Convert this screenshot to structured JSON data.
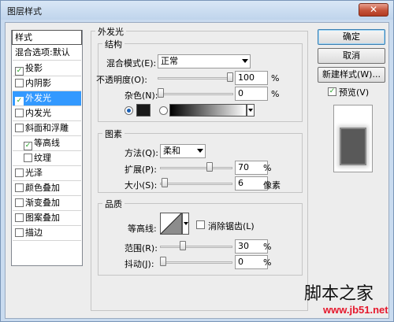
{
  "window": {
    "title": "图层样式",
    "close_label": "✕"
  },
  "style_list": {
    "header": "样式",
    "blend_default": "混合选项:默认",
    "items": [
      {
        "label": "投影",
        "checked": true
      },
      {
        "label": "内阴影",
        "checked": false
      },
      {
        "label": "外发光",
        "checked": true,
        "selected": true
      },
      {
        "label": "内发光",
        "checked": false
      },
      {
        "label": "斜面和浮雕",
        "checked": false
      },
      {
        "label": "等高线",
        "checked": true,
        "indent": true
      },
      {
        "label": "纹理",
        "checked": false,
        "indent": true
      },
      {
        "label": "光泽",
        "checked": false
      },
      {
        "label": "颜色叠加",
        "checked": false
      },
      {
        "label": "渐变叠加",
        "checked": false
      },
      {
        "label": "图案叠加",
        "checked": false
      },
      {
        "label": "描边",
        "checked": false
      }
    ]
  },
  "outer_glow": {
    "title": "外发光",
    "structure": {
      "title": "结构",
      "blend_mode_label": "混合模式(E):",
      "blend_mode_value": "正常",
      "opacity_label": "不透明度(O):",
      "opacity_value": "100",
      "opacity_fraction": 1.0,
      "noise_label": "杂色(N):",
      "noise_value": "0",
      "noise_fraction": 0.0,
      "unit": "%"
    },
    "elements": {
      "title": "图素",
      "technique_label": "方法(Q):",
      "technique_value": "柔和",
      "spread_label": "扩展(P):",
      "spread_value": "70",
      "spread_fraction": 0.7,
      "size_label": "大小(S):",
      "size_value": "6",
      "size_fraction": 0.024,
      "unit_percent": "%",
      "unit_px": "像素"
    },
    "quality": {
      "title": "品质",
      "contour_label": "等高线:",
      "anti_alias_label": "消除锯齿(L)",
      "range_label": "范围(R):",
      "range_value": "30",
      "range_fraction": 0.3,
      "jitter_label": "抖动(J):",
      "jitter_value": "0",
      "jitter_fraction": 0.0,
      "unit": "%"
    },
    "glow_color": "#1a1a1a"
  },
  "buttons": {
    "ok": "确定",
    "cancel": "取消",
    "new_style": "新建样式(W)...",
    "preview_label": "预览(V)",
    "preview_checked": true
  },
  "watermark": {
    "cn": "脚本之家",
    "url": "www.jb51.net"
  }
}
